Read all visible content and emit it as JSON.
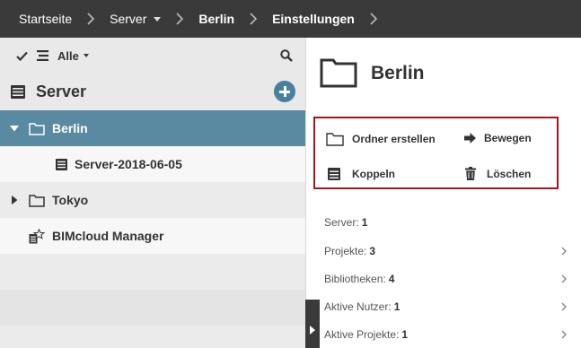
{
  "breadcrumb": {
    "items": [
      {
        "label": "Startseite"
      },
      {
        "label": "Server"
      },
      {
        "label": "Berlin"
      },
      {
        "label": "Einstellungen"
      }
    ]
  },
  "left_panel": {
    "filter_label": "Alle",
    "section_title": "Server",
    "tree": [
      {
        "label": "Berlin",
        "icon": "folder-icon"
      },
      {
        "label": "Server-2018-06-05",
        "icon": "server-icon"
      },
      {
        "label": "Tokyo",
        "icon": "folder-icon"
      },
      {
        "label": "BIMcloud Manager",
        "icon": "manager-icon"
      }
    ]
  },
  "right_panel": {
    "title": "Berlin",
    "actions": [
      {
        "label": "Ordner erstellen",
        "icon": "folder-icon"
      },
      {
        "label": "Bewegen",
        "icon": "arrow-right-icon"
      },
      {
        "label": "Koppeln",
        "icon": "server-icon"
      },
      {
        "label": "Löschen",
        "icon": "trash-icon"
      }
    ],
    "stats": [
      {
        "label": "Server:",
        "value": "1",
        "expandable": false
      },
      {
        "label": "Projekte:",
        "value": "3",
        "expandable": true
      },
      {
        "label": "Bibliotheken:",
        "value": "4",
        "expandable": true
      },
      {
        "label": "Aktive Nutzer:",
        "value": "1",
        "expandable": true
      },
      {
        "label": "Aktive Projekte:",
        "value": "1",
        "expandable": true
      }
    ]
  },
  "colors": {
    "topbar": "#3a3a3a",
    "selected_row": "#5a8aa2",
    "accent_blue": "#4a7fa0",
    "highlight_border": "#a8141c"
  }
}
